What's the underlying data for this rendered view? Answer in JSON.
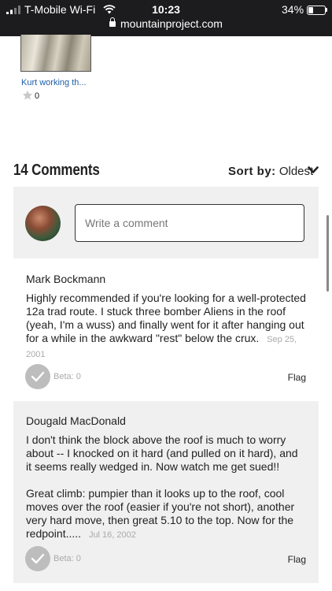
{
  "status_bar": {
    "carrier": "T-Mobile Wi-Fi",
    "time": "10:23",
    "battery": "34%",
    "battery_level": 0.34,
    "url": "mountainproject.com"
  },
  "photo": {
    "caption": "Kurt working th...",
    "star_count": "0"
  },
  "comments_header": {
    "title": "14 Comments",
    "sort_label": "Sort by:",
    "sort_value": "Oldest"
  },
  "new_comment": {
    "placeholder": "Write a comment"
  },
  "comments": [
    {
      "author": "Mark Bockmann",
      "paragraphs": [
        "Highly recommended if you're looking for a well-protected 12a trad route. I stuck three bomber Aliens in the roof (yeah, I'm a wuss) and finally went for it after hanging out for a while in the awkward \"rest\" below the crux."
      ],
      "date": "Sep 25, 2001",
      "beta": "Beta: 0",
      "flag": "Flag"
    },
    {
      "author": "Dougald MacDonald",
      "paragraphs": [
        "I don't think the block above the roof is much to worry about -- I knocked on it hard (and pulled on it hard), and it seems really wedged in. Now watch me get sued!!",
        "Great climb: pumpier than it looks up to the roof, cool moves over the roof (easier if you're not short), another very hard move, then great 5.10 to the top. Now for the redpoint....."
      ],
      "date": "Jul 16, 2002",
      "beta": "Beta: 0",
      "flag": "Flag"
    }
  ]
}
